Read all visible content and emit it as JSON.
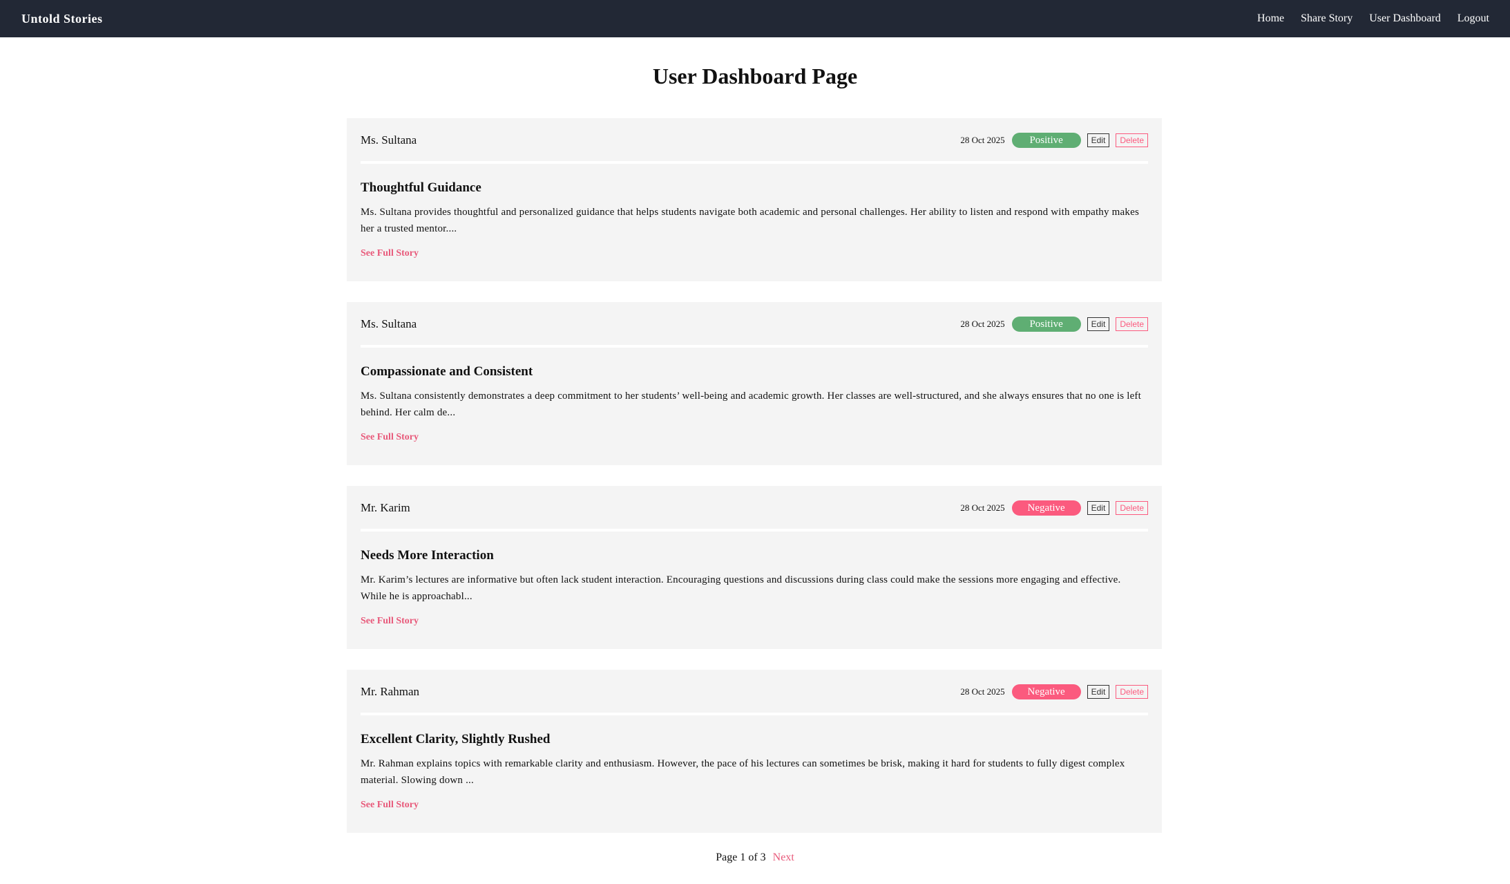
{
  "navbar": {
    "brand": "Untold Stories",
    "links": [
      "Home",
      "Share Story",
      "User Dashboard",
      "Logout"
    ]
  },
  "page": {
    "title": "User Dashboard Page"
  },
  "colors": {
    "navbar": "#222835",
    "positive": "#5fae73",
    "negative": "#fb5a7e",
    "accent": "#e8597a",
    "card": "#f4f4f4"
  },
  "actions": {
    "edit_label": "Edit",
    "delete_label": "Delete",
    "see_full_label": "See Full Story"
  },
  "stories": [
    {
      "teacher": "Ms. Sultana",
      "date": "28 Oct 2025",
      "sentiment": "Positive",
      "title": "Thoughtful Guidance",
      "excerpt": "Ms. Sultana provides thoughtful and personalized guidance that helps students navigate both academic and personal challenges. Her ability to listen and respond with empathy makes her a trusted mentor...."
    },
    {
      "teacher": "Ms. Sultana",
      "date": "28 Oct 2025",
      "sentiment": "Positive",
      "title": "Compassionate and Consistent",
      "excerpt": "Ms. Sultana consistently demonstrates a deep commitment to her students’ well-being and academic growth. Her classes are well-structured, and she always ensures that no one is left behind. Her calm de..."
    },
    {
      "teacher": "Mr. Karim",
      "date": "28 Oct 2025",
      "sentiment": "Negative",
      "title": "Needs More Interaction",
      "excerpt": "Mr. Karim’s lectures are informative but often lack student interaction. Encouraging questions and discussions during class could make the sessions more engaging and effective. While he is approachabl..."
    },
    {
      "teacher": "Mr. Rahman",
      "date": "28 Oct 2025",
      "sentiment": "Negative",
      "title": "Excellent Clarity, Slightly Rushed",
      "excerpt": "Mr. Rahman explains topics with remarkable clarity and enthusiasm. However, the pace of his lectures can sometimes be brisk, making it hard for students to fully digest complex material. Slowing down ..."
    }
  ],
  "pagination": {
    "info": "Page 1 of 3",
    "next": "Next"
  }
}
